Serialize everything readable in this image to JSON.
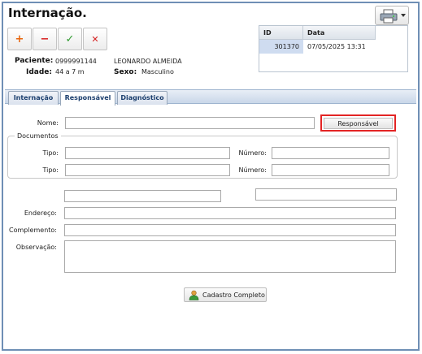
{
  "header": {
    "title": "Internação."
  },
  "toolbar": {
    "add_glyph": "+",
    "remove_glyph": "−",
    "confirm_glyph": "✓",
    "cancel_glyph": "✕",
    "print_icon": "printer-icon"
  },
  "patient": {
    "paciente_label": "Paciente:",
    "paciente_id": "0999991144",
    "paciente_name": "LEONARDO ALMEIDA",
    "idade_label": "Idade:",
    "idade_value": "44 a 7 m",
    "sexo_label": "Sexo:",
    "sexo_value": "Masculino"
  },
  "admissions_grid": {
    "columns": [
      "ID",
      "Data"
    ],
    "rows": [
      {
        "id": "301370",
        "data": "07/05/2025 13:31"
      }
    ]
  },
  "tabs": [
    "Internação",
    "Responsável",
    "Diagnóstico"
  ],
  "active_tab": "Responsável",
  "form": {
    "nome_label": "Nome:",
    "nome_value": "",
    "responsavel_button": "Responsável",
    "documentos_legend": "Documentos",
    "tipo_label": "Tipo:",
    "numero_label": "Número:",
    "endereco_label": "Endereço:",
    "complemento_label": "Complemento:",
    "observacao_label": "Observação:",
    "cadastro_button": "Cadastro Completo"
  },
  "colors": {
    "window_border": "#6f8fb5",
    "tab_text": "#1c3f6e",
    "highlight": "#e32424",
    "add_icon": "#e8640c",
    "remove_icon": "#d92020",
    "confirm_icon": "#2e9a2e",
    "cancel_icon": "#d42020",
    "grid_selected": "#cfdcf0"
  }
}
